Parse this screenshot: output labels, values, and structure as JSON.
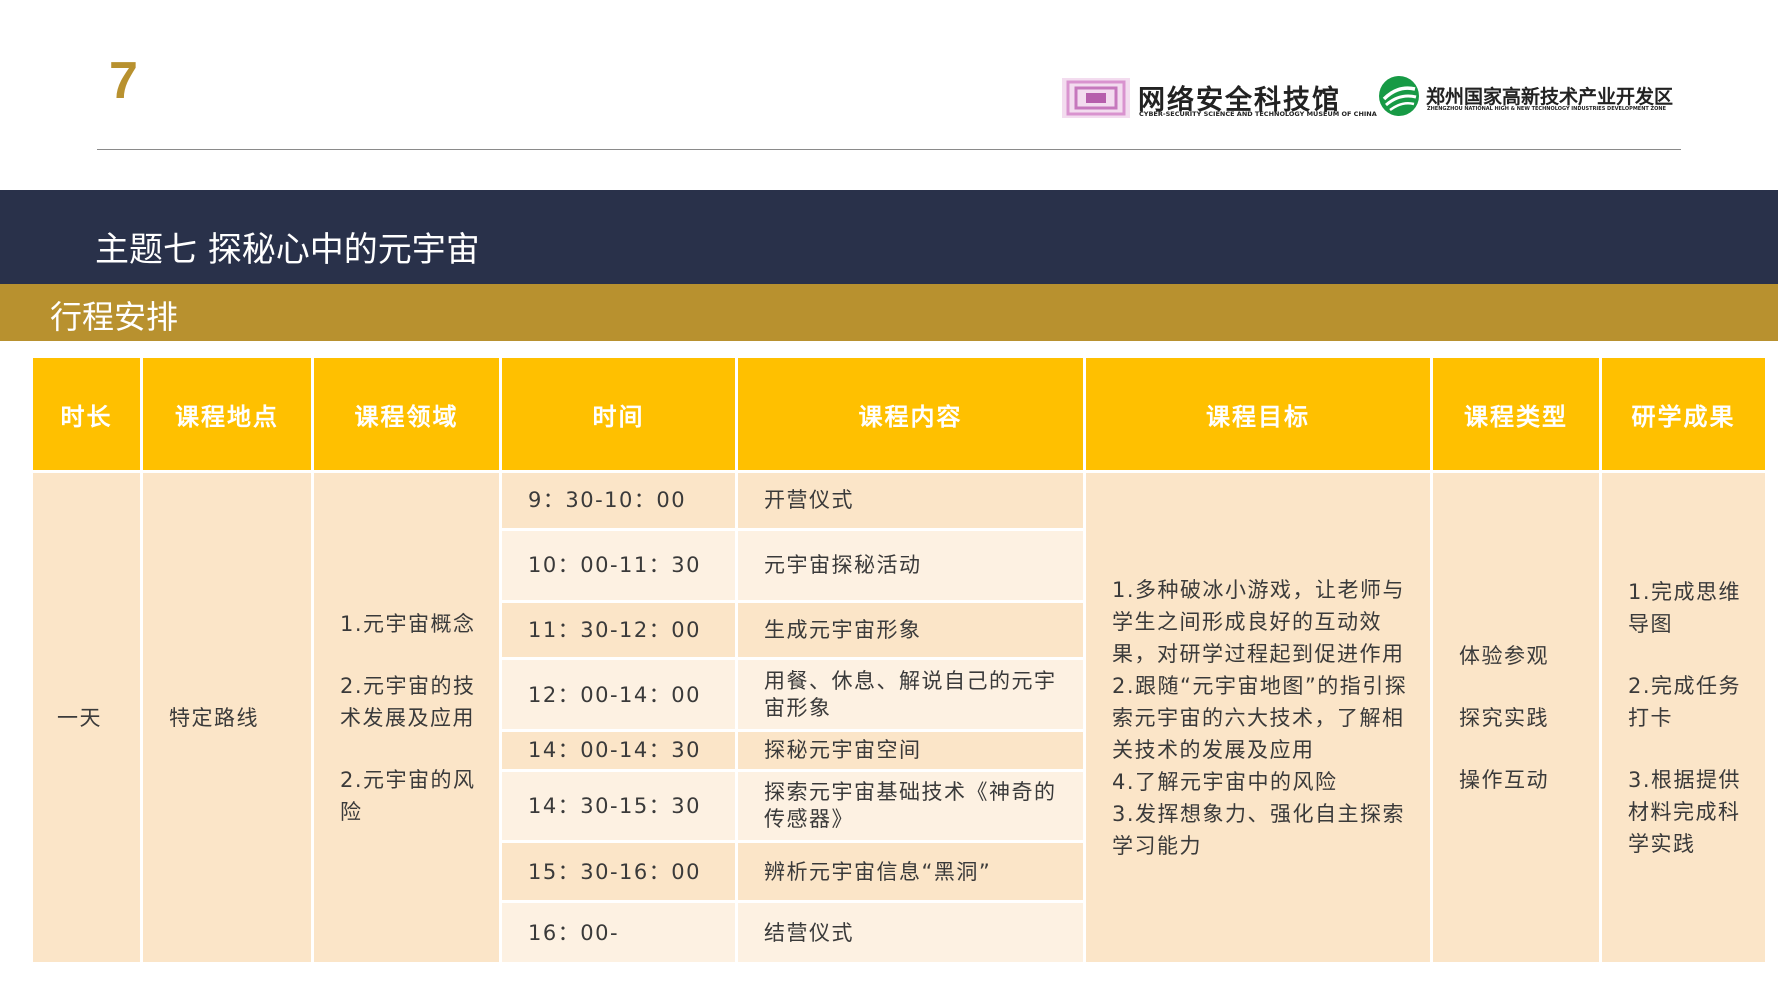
{
  "page_number": "7",
  "logos": {
    "cyber_museum": {
      "name": "网络安全科技馆",
      "subtitle": "CYBER-SECURITY SCIENCE AND TECHNOLOGY MUSEUM OF CHINA"
    },
    "zhengzhou_zone": {
      "name": "郑州国家高新技术产业开发区",
      "subtitle": "ZHENGZHOU NATIONAL HIGH & NEW TECHNOLOGY INDUSTRIES DEVELOPMENT ZONE"
    }
  },
  "theme_title": "主题七 探秘心中的元宇宙",
  "section_title": "行程安排",
  "colors": {
    "banner": "#29314a",
    "gold": "#b8912f",
    "header_yellow": "#ffc000",
    "cell_light": "#fdf1e2",
    "cell_peach": "#fbe5c8"
  },
  "table": {
    "headers": [
      "时长",
      "课程地点",
      "课程领域",
      "时间",
      "课程内容",
      "课程目标",
      "课程类型",
      "研学成果"
    ],
    "duration": "一天",
    "location": "特定路线",
    "domains": [
      "1.元宇宙概念",
      "2.元宇宙的技术发展及应用",
      "2.元宇宙的风险"
    ],
    "rows": [
      {
        "time": "9：30-10：00",
        "content": "开营仪式"
      },
      {
        "time": "10：00-11：30",
        "content": "元宇宙探秘活动"
      },
      {
        "time": "11：30-12：00",
        "content": "生成元宇宙形象"
      },
      {
        "time": "12：00-14：00",
        "content": "用餐、休息、解说自己的元宇宙形象"
      },
      {
        "time": "14：00-14：30",
        "content": "探秘元宇宙空间"
      },
      {
        "time": "14：30-15：30",
        "content": "探索元宇宙基础技术《神奇的传感器》"
      },
      {
        "time": "15：30-16：00",
        "content": "辨析元宇宙信息“黑洞”"
      },
      {
        "time": "16：00-",
        "content": "结营仪式"
      }
    ],
    "goals": [
      "1.多种破冰小游戏，让老师与学生之间形成良好的互动效果，对研学过程起到促进作用",
      "2.跟随“元宇宙地图”的指引探索元宇宙的六大技术，了解相关技术的发展及应用",
      "4.了解元宇宙中的风险",
      "3.发挥想象力、强化自主探索学习能力"
    ],
    "types": [
      "体验参观",
      "探究实践",
      "操作互动"
    ],
    "outcomes": [
      "1.完成思维导图",
      "2.完成任务打卡",
      "3.根据提供材料完成科学实践"
    ]
  }
}
